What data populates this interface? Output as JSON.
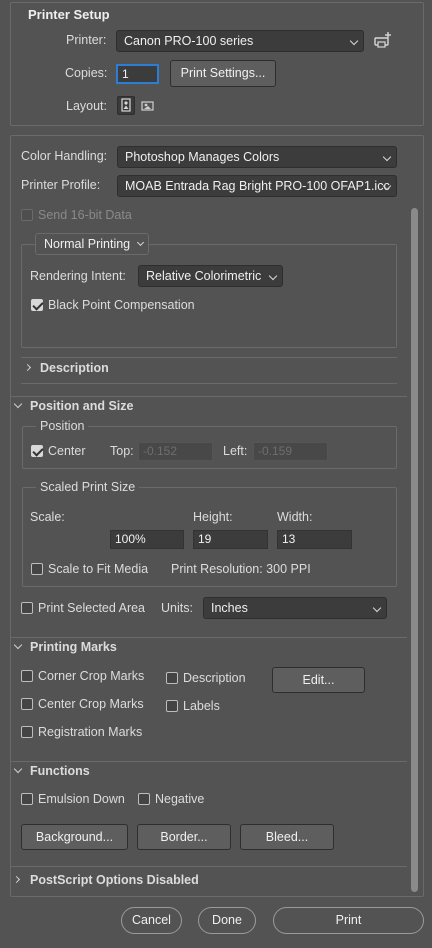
{
  "printer_setup": {
    "title": "Printer Setup",
    "printer_label": "Printer:",
    "printer_value": "Canon PRO-100 series",
    "copies_label": "Copies:",
    "copies_value": "1",
    "print_settings_label": "Print Settings...",
    "layout_label": "Layout:"
  },
  "color": {
    "handling_label": "Color Handling:",
    "handling_value": "Photoshop Manages Colors",
    "profile_label": "Printer Profile:",
    "profile_value": "MOAB Entrada Rag Bright PRO-100 OFAP1.icc",
    "send16_label": "Send 16-bit Data",
    "mode_value": "Normal Printing",
    "intent_label": "Rendering Intent:",
    "intent_value": "Relative Colorimetric",
    "bpc_label": "Black Point Compensation",
    "bpc_checked": true
  },
  "description": {
    "title": "Description"
  },
  "position_size": {
    "title": "Position and Size",
    "position_group": "Position",
    "center_label": "Center",
    "top_label": "Top:",
    "top_value": "-0.152",
    "left_label": "Left:",
    "left_value": "-0.159",
    "scaled_group": "Scaled Print Size",
    "scale_label": "Scale:",
    "height_label": "Height:",
    "width_label": "Width:",
    "scale_value": "100%",
    "height_value": "19",
    "width_value": "13",
    "fit_label": "Scale to Fit Media",
    "resolution_text": "Print Resolution: 300 PPI",
    "selected_area_label": "Print Selected Area",
    "units_label": "Units:",
    "units_value": "Inches"
  },
  "marks": {
    "title": "Printing Marks",
    "corner_crop": "Corner Crop Marks",
    "description": "Description",
    "edit_label": "Edit...",
    "center_crop": "Center Crop Marks",
    "labels": "Labels",
    "registration": "Registration Marks"
  },
  "functions": {
    "title": "Functions",
    "emulsion": "Emulsion Down",
    "negative": "Negative",
    "background": "Background...",
    "border": "Border...",
    "bleed": "Bleed..."
  },
  "postscript": {
    "title": "PostScript Options Disabled"
  },
  "footer": {
    "cancel": "Cancel",
    "done": "Done",
    "print": "Print"
  },
  "colors": {
    "panel": "#535353",
    "field": "#3c3c3c",
    "text": "#e6e6e6",
    "accent": "#2a7fd4"
  }
}
